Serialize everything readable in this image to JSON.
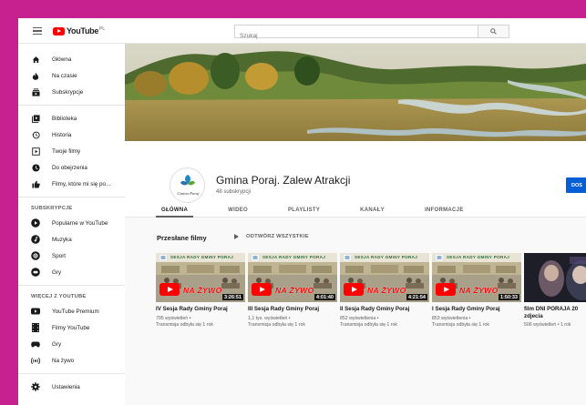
{
  "topbar": {
    "logo_text": "YouTube",
    "logo_suffix": "PL",
    "search_placeholder": "Szukaj"
  },
  "sidebar": {
    "main": [
      {
        "label": "Główna",
        "icon": "home-icon"
      },
      {
        "label": "Na czasie",
        "icon": "fire-icon"
      },
      {
        "label": "Subskrypcje",
        "icon": "subscriptions-icon"
      }
    ],
    "library": [
      {
        "label": "Biblioteka",
        "icon": "library-icon"
      },
      {
        "label": "Historia",
        "icon": "history-icon"
      },
      {
        "label": "Twoje filmy",
        "icon": "your-videos-icon"
      },
      {
        "label": "Do obejrzenia",
        "icon": "watch-later-icon"
      },
      {
        "label": "Filmy, które mi się po...",
        "icon": "like-icon"
      }
    ],
    "subscriptions_heading": "SUBSKRYPCJE",
    "subscriptions": [
      {
        "label": "Popularne w YouTube",
        "icon": "popular-icon"
      },
      {
        "label": "Muzyka",
        "icon": "music-icon"
      },
      {
        "label": "Sport",
        "icon": "sport-icon"
      },
      {
        "label": "Gry",
        "icon": "gaming-icon"
      }
    ],
    "more_heading": "WIĘCEJ Z YOUTUBE",
    "more": [
      {
        "label": "YouTube Premium",
        "icon": "premium-icon"
      },
      {
        "label": "Filmy YouTube",
        "icon": "movies-icon"
      },
      {
        "label": "Gry",
        "icon": "gaming-controller-icon"
      },
      {
        "label": "Na żywo",
        "icon": "live-icon"
      }
    ],
    "settings": {
      "label": "Ustawienia",
      "icon": "settings-icon"
    }
  },
  "channel": {
    "name": "Gmina Poraj. Zalew Atrakcji",
    "subscribers": "48 subskrypcji",
    "avatar_text": "Gmina Poraj",
    "subscribe_label": "DOS"
  },
  "tabs": [
    "GŁÓWNA",
    "WIDEO",
    "PLAYLISTY",
    "KANAŁY",
    "INFORMACJE"
  ],
  "uploads": {
    "title": "Przesłane filmy",
    "play_all": "ODTWÓRZ WSZYSTKIE"
  },
  "videos": [
    {
      "title": "IV Sesja Rady Gminy Poraj",
      "views": "795 wyświetleń •",
      "meta": "Transmisja odbyła się 1 rok",
      "duration": "3:26:51",
      "badge": "NA ŻYWO",
      "header": "SESJA RADY GMINY PORAJ"
    },
    {
      "title": "III Sesja Rady Gminy Poraj",
      "views": "1,1 tys. wyświetleń •",
      "meta": "Transmisja odbyła się 1 rok",
      "duration": "4:01:40",
      "badge": "NA ŻYWO",
      "header": "SESJA RADY GMINY PORAJ"
    },
    {
      "title": "II Sesja Rady Gminy Poraj",
      "views": "852 wyświetlenia •",
      "meta": "Transmisja odbyła się 1 rok",
      "duration": "4:21:54",
      "badge": "NA ŻYWO",
      "header": "SESJA RADY GMINY PORAJ"
    },
    {
      "title": "I Sesja Rady Gminy Poraj",
      "views": "853 wyświetlenia •",
      "meta": "Transmisja odbyła się 1 rok",
      "duration": "1:50:33",
      "badge": "NA ŻYWO",
      "header": "SESJA RADY GMINY PORAJ"
    },
    {
      "title": "film DNI PORAJA 20",
      "title2": "zdjecia",
      "views": "506 wyświetleń • 1 rok",
      "meta": "",
      "duration": "",
      "badge": "",
      "header": ""
    }
  ],
  "colors": {
    "accent": "#ff0000",
    "subscribe": "#065fd4",
    "outer_bg": "#c7218f"
  }
}
